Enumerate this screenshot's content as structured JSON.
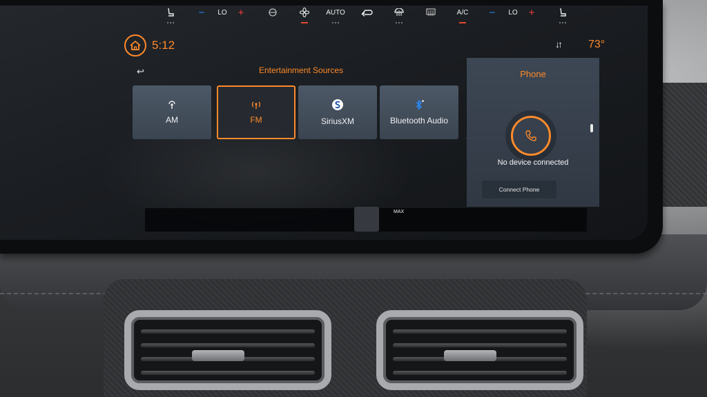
{
  "status_bar": {
    "time": "5:12",
    "temperature": "73°",
    "icons": [
      "home-icon",
      "sort-arrows-icon",
      "back-arrow-icon"
    ]
  },
  "entertainment": {
    "title": "Entertainment Sources",
    "sources": [
      {
        "label": "AM",
        "icon": "am-radio-icon",
        "selected": false
      },
      {
        "label": "FM",
        "icon": "fm-radio-icon",
        "selected": true
      },
      {
        "label": "SiriusXM",
        "icon": "siriusxm-icon",
        "selected": false
      },
      {
        "label": "Bluetooth Audio",
        "icon": "bluetooth-icon",
        "selected": false
      }
    ]
  },
  "phone": {
    "title": "Phone",
    "status": "No device connected",
    "connect_label": "Connect Phone"
  },
  "climate": {
    "left_fan_level": "LO",
    "right_fan_level": "LO",
    "auto_label": "AUTO",
    "max_label": "MAX",
    "ac_label": "A/C",
    "minus": "−",
    "plus": "+"
  },
  "colors": {
    "accent": "#ff8a2a",
    "tile": "#45505d",
    "climate_minus": "#2a8dff",
    "climate_plus": "#ff3b3b"
  }
}
